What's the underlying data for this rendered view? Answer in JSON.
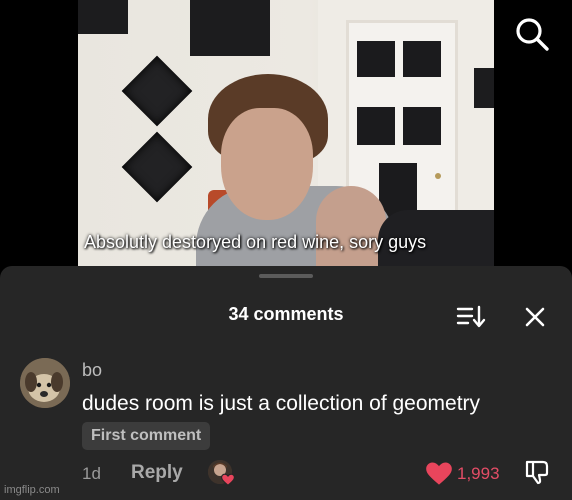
{
  "video": {
    "caption": "Absolutly destoryed on red wine, sory guys",
    "search_icon": "search-icon"
  },
  "comments_panel": {
    "count_label": "34 comments",
    "sort_icon": "sort-icon",
    "close_icon": "close-icon"
  },
  "comment": {
    "username": "bo",
    "text": "dudes room is just a collection of geometry",
    "badge": "First comment",
    "time": "1d",
    "reply_label": "Reply",
    "likes": "1,993",
    "like_color": "#e8455c",
    "icons": [
      "heart-icon",
      "dislike-icon",
      "creator-liked-icon"
    ]
  },
  "watermark": "imgflip.com"
}
